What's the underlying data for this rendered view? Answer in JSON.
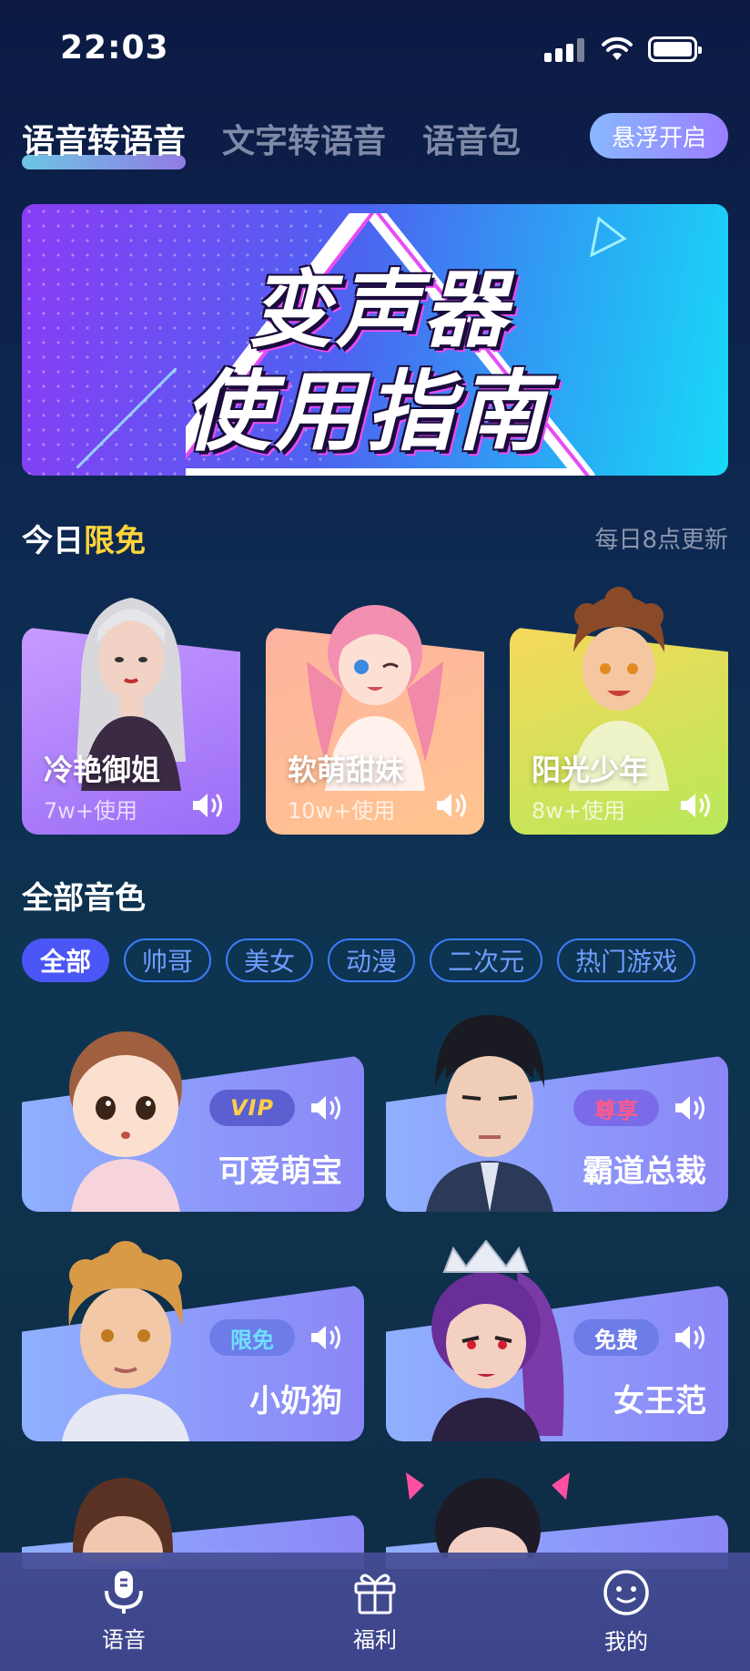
{
  "status_bar": {
    "time": "22:03"
  },
  "top_tabs": [
    {
      "label": "语音转语音",
      "active": true
    },
    {
      "label": "文字转语音",
      "active": false
    },
    {
      "label": "语音包",
      "active": false
    }
  ],
  "float_button": {
    "label": "悬浮开启"
  },
  "banner": {
    "line1": "变声器",
    "line2": "使用指南"
  },
  "free_section": {
    "title_prefix": "今日",
    "title_highlight": "限免",
    "subtitle": "每日8点更新"
  },
  "free_cards": [
    {
      "name": "冷艳御姐",
      "uses": "7w+使用"
    },
    {
      "name": "软萌甜妹",
      "uses": "10w+使用"
    },
    {
      "name": "阳光少年",
      "uses": "8w+使用"
    }
  ],
  "all_section": {
    "title": "全部音色"
  },
  "filters": [
    "全部",
    "帅哥",
    "美女",
    "动漫",
    "二次元",
    "热门游戏"
  ],
  "voices": [
    {
      "name": "可爱萌宝",
      "badge": "VIP"
    },
    {
      "name": "霸道总裁",
      "badge": "尊享"
    },
    {
      "name": "小奶狗",
      "badge": "限免"
    },
    {
      "name": "女王范",
      "badge": "免费"
    }
  ],
  "bottom_nav": [
    {
      "label": "语音",
      "icon": "microphone-icon"
    },
    {
      "label": "福利",
      "icon": "gift-icon"
    },
    {
      "label": "我的",
      "icon": "smiley-icon"
    }
  ],
  "colors": {
    "accent": "#4a56f5",
    "highlight": "#ffd43a"
  }
}
